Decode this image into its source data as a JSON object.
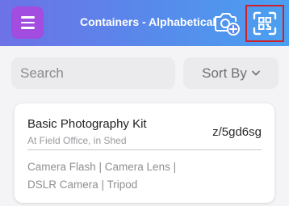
{
  "header": {
    "title": "Containers - Alphabetical",
    "gradient_start": "#6d72e6",
    "gradient_end": "#4aa0f0",
    "menu_color": "#a24ce0",
    "icons": [
      "menu-icon",
      "add-photo-icon",
      "qr-scan-icon"
    ]
  },
  "toolbar": {
    "search_placeholder": "Search",
    "sort_label": "Sort By"
  },
  "containers": [
    {
      "name": "Basic Photography Kit",
      "location": "At Field Office, in Shed",
      "code": "z/5gd6sg",
      "items_line1": "Camera Flash | Camera Lens |",
      "items_line2": "DSLR Camera | Tripod"
    }
  ]
}
